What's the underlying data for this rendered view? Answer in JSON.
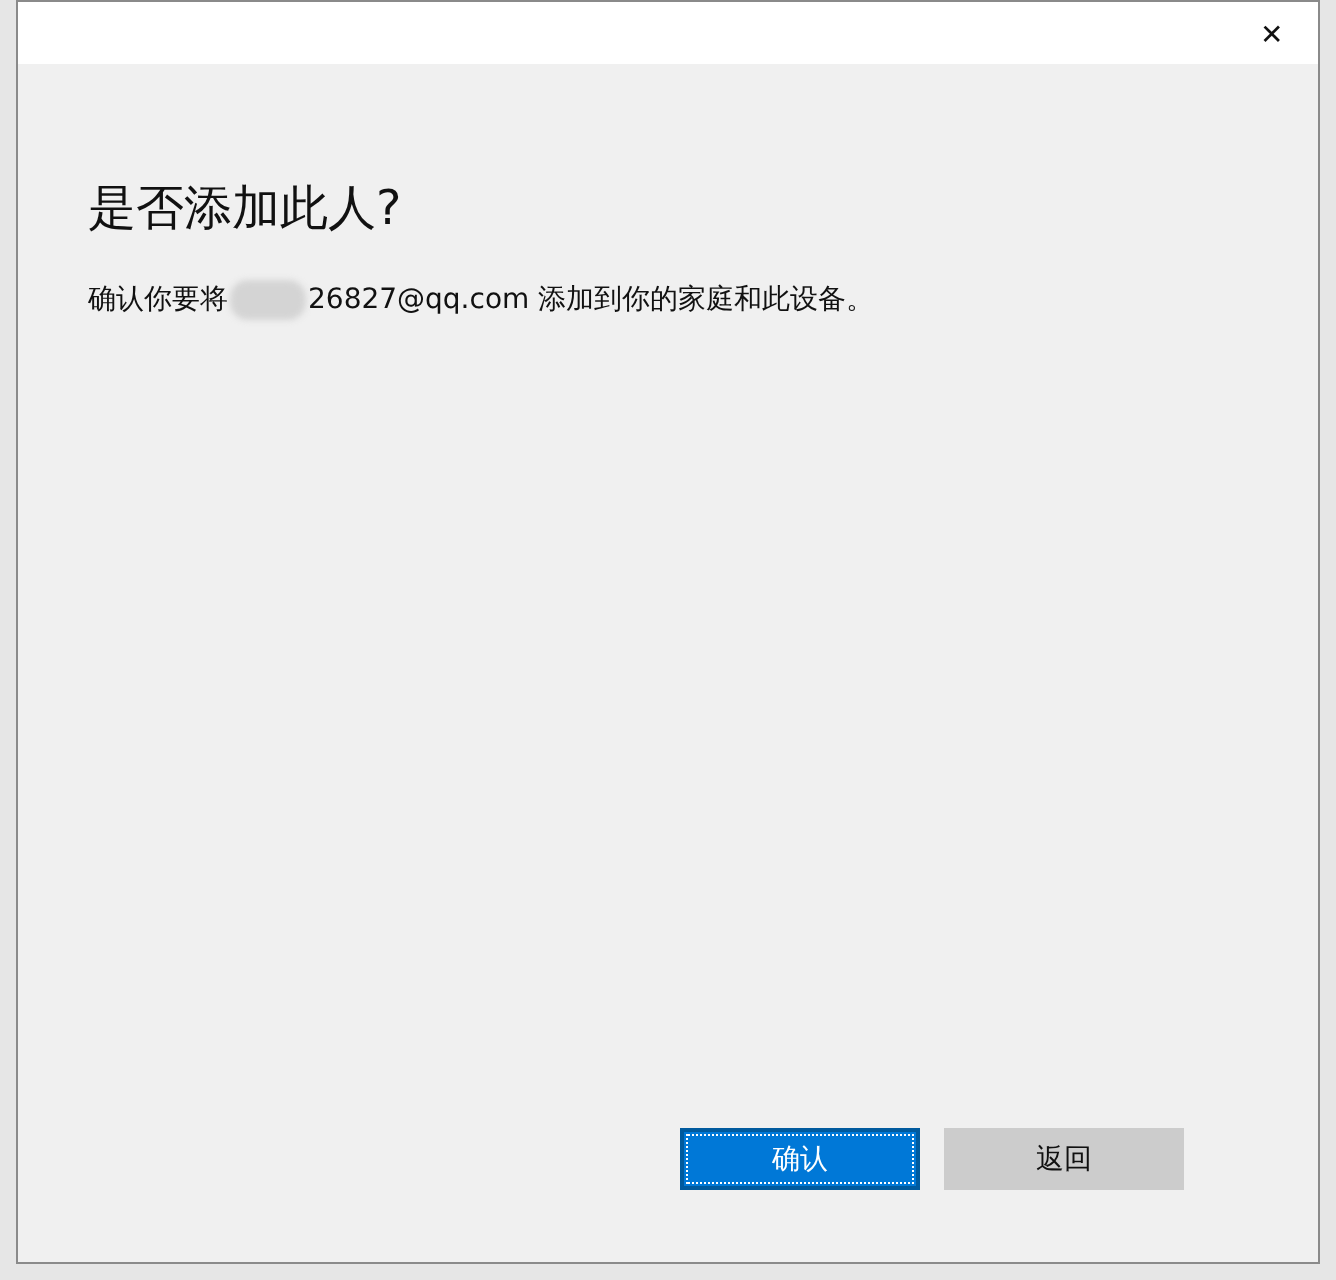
{
  "window": {
    "close": "✕"
  },
  "dialog": {
    "title": "是否添加此人?",
    "message_prefix": "确认你要将",
    "message_suffix": "26827@qq.com 添加到你的家庭和此设备。"
  },
  "buttons": [
    {
      "label": "确认",
      "kind": "primary",
      "focused": true
    },
    {
      "label": "返回",
      "kind": "secondary",
      "focused": false
    }
  ]
}
